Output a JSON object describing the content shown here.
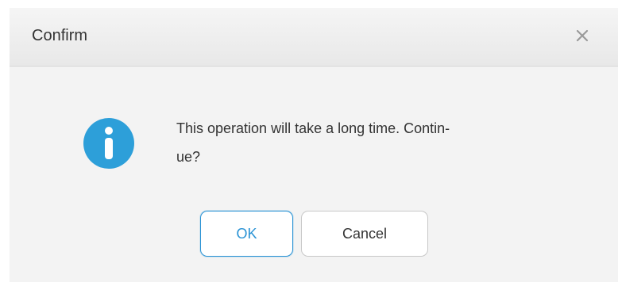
{
  "dialog": {
    "title": "Confirm",
    "message": "This operation will take a long time. Contin-ue?",
    "message_line1": "This operation will take a long time. Contin-",
    "message_line2": "ue?",
    "icon": "info-icon",
    "buttons": {
      "ok_label": "OK",
      "cancel_label": "Cancel"
    },
    "colors": {
      "accent": "#2a93d5",
      "icon_blue": "#2d9fd9"
    }
  }
}
